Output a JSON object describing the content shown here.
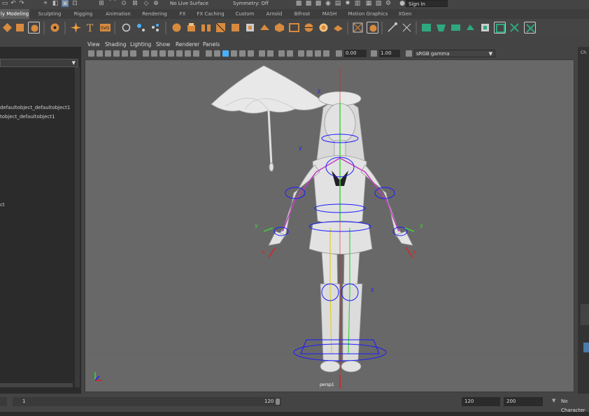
{
  "status_line": {
    "surface_dropdown": "No Live Surface",
    "symmetry_dropdown": "Symmetry: Off",
    "sign_in": "Sign In"
  },
  "shelf_tabs": [
    {
      "label": "ly Modeling",
      "active": true
    },
    {
      "label": "Sculpting",
      "active": false
    },
    {
      "label": "Rigging",
      "active": false
    },
    {
      "label": "Animation",
      "active": false
    },
    {
      "label": "Rendering",
      "active": false
    },
    {
      "label": "FX",
      "active": false
    },
    {
      "label": "FX Caching",
      "active": false
    },
    {
      "label": "Custom",
      "active": false
    },
    {
      "label": "Arnold",
      "active": false
    },
    {
      "label": "Bifrost",
      "active": false
    },
    {
      "label": "MASH",
      "active": false
    },
    {
      "label": "Motion Graphics",
      "active": false
    },
    {
      "label": "XGen",
      "active": false
    }
  ],
  "outliner": {
    "items": [
      "defaultobject_defaultobject1",
      "tobject_defaultobject1",
      "ct"
    ]
  },
  "viewport_menu": {
    "view": "View",
    "shading": "Shading",
    "lighting": "Lighting",
    "show": "Show",
    "renderer": "Renderer",
    "panels": "Panels"
  },
  "viewport_toolbar": {
    "exposure": "0.00",
    "gamma": "1.00",
    "color_space": "sRGB gamma"
  },
  "camera_label": "persp1",
  "axis_labels": {
    "y": "y",
    "z": "z",
    "x": "x"
  },
  "timeline": {
    "current_frame": "1",
    "range_end_label": "120",
    "playback_end": "120",
    "animation_end": "200",
    "character_set": "No Character"
  },
  "colors": {
    "viewport_bg": "#686868",
    "active_tab": "#5e5e5e",
    "shelf_orange": "#d88a3e",
    "shelf_teal": "#2fa87f",
    "joint_blue": "#1a1aff",
    "bone_green": "#3cd43c",
    "bone_red": "#e02020",
    "bone_yellow": "#e0d020",
    "bone_purple": "#c040c0"
  }
}
